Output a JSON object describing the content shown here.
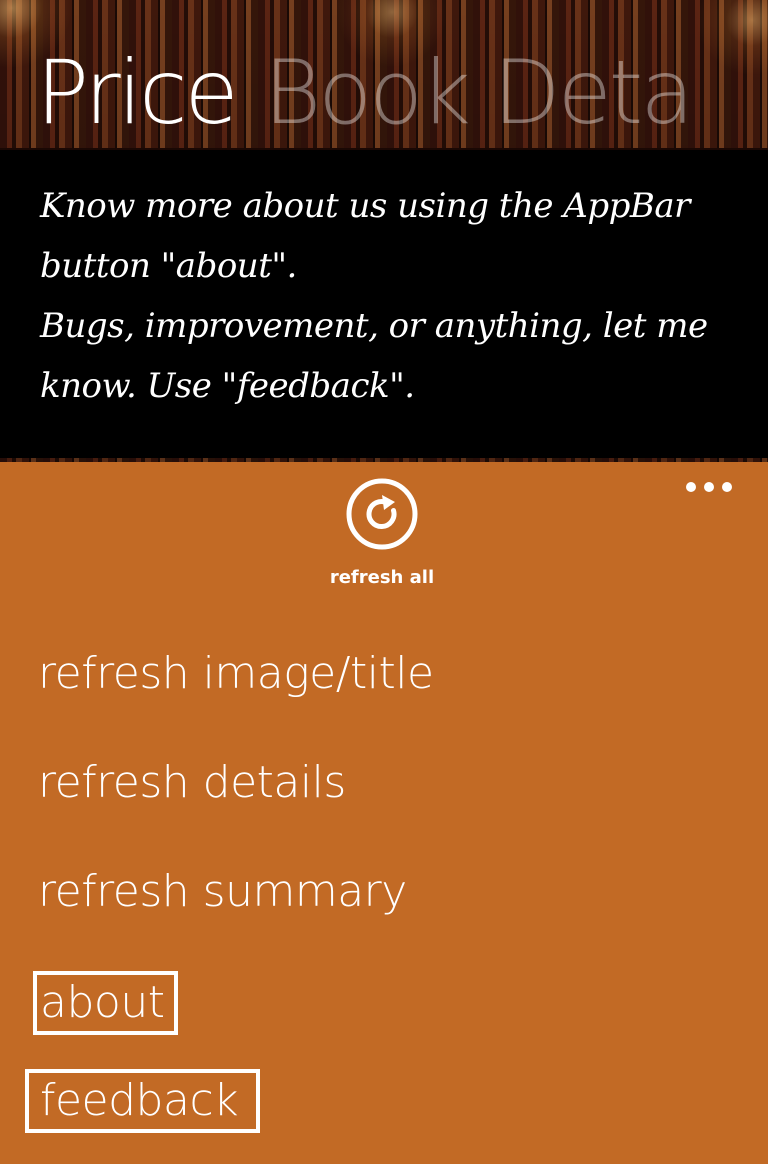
{
  "pivot": {
    "active_title": "Price",
    "next_title": "Book Deta"
  },
  "info": {
    "line1": "Know more about us using the AppBar button \"about\".",
    "line2": "Bugs, improvement, or anything, let me know. Use \"feedback\"."
  },
  "appbar": {
    "icon_buttons": [
      {
        "label": "refresh all",
        "icon": "refresh-icon"
      }
    ],
    "menu_items": [
      {
        "label": "refresh image/title"
      },
      {
        "label": "refresh details"
      },
      {
        "label": "refresh summary"
      },
      {
        "label": "about"
      },
      {
        "label": "feedback"
      }
    ],
    "more_icon": "ellipsis-icon",
    "background_color": "#c26a25"
  },
  "colors": {
    "accent": "#c26a25",
    "panel": "#000000",
    "text": "#ffffff"
  }
}
